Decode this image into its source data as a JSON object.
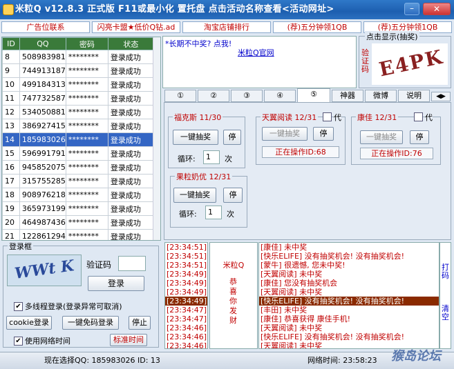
{
  "window": {
    "title": "米粒Q v12.8.3 正式版   F11或最小化 置托盘   点击活动名称查看<活动网址>",
    "min_label": "–",
    "close_label": "✕"
  },
  "ads": [
    "广告位联系",
    "闪亮卡盟★低价Q钻.ad",
    "淘宝店铺排行",
    "(荐)五分钟领1QB",
    "(荐)五分钟领1QB"
  ],
  "accounts": {
    "headers": [
      "ID",
      "QQ",
      "密码",
      "状态"
    ],
    "rows": [
      [
        "8",
        "508983981",
        "********",
        "登录成功"
      ],
      [
        "9",
        "744913187",
        "********",
        "登录成功"
      ],
      [
        "10",
        "499184313",
        "********",
        "登录成功"
      ],
      [
        "11",
        "747732587",
        "********",
        "登录成功"
      ],
      [
        "12",
        "534050881",
        "********",
        "登录成功"
      ],
      [
        "13",
        "386927415",
        "********",
        "登录成功"
      ],
      [
        "14",
        "185983026",
        "********",
        "登录成功"
      ],
      [
        "15",
        "596991791",
        "********",
        "登录成功"
      ],
      [
        "16",
        "945852075",
        "********",
        "登录成功"
      ],
      [
        "17",
        "315755285",
        "********",
        "登录成功"
      ],
      [
        "18",
        "908976218",
        "********",
        "登录成功"
      ],
      [
        "19",
        "365973199",
        "********",
        "登录成功"
      ],
      [
        "20",
        "464987436",
        "********",
        "登录成功"
      ],
      [
        "21",
        "122861294",
        "********",
        "登录成功"
      ]
    ]
  },
  "login": {
    "legend": "登录框",
    "captcha_label": "验证码",
    "captcha_value": "",
    "login_button": "登录",
    "multithread_label": "多线程登录(登录异常可取消)",
    "cookie_button": "cookie登录",
    "quick_button": "一键免码登录",
    "stop_button": "停止",
    "network_time_label": "使用网络时间",
    "standard_time_button": "标准时间",
    "captcha_image_text": "WWt K"
  },
  "notice": {
    "line1": "*长期不中奖? 点我!",
    "line2": "米粒Q官网"
  },
  "captcha_panel": {
    "legend": "点击显示(抽奖)",
    "label": "验证码",
    "image_text": "E4PK"
  },
  "tabs": [
    "①",
    "②",
    "③",
    "④",
    "⑤",
    "神器",
    "微博",
    "说明"
  ],
  "groups": [
    {
      "title": "福克斯 11/30",
      "draw": "一键抽奖",
      "stop": "停",
      "loop_label": "循环:",
      "loop_value": "1",
      "loop_unit": "次"
    },
    {
      "title": "天翼阅读 12/31",
      "proxy": "代",
      "draw": "一键抽奖",
      "stop": "停",
      "status": "正在操作ID:68"
    },
    {
      "title": "康佳 12/31",
      "proxy": "代",
      "draw": "一键抽奖",
      "stop": "停",
      "status": "正在操作ID:76"
    },
    {
      "title": "果粒奶优 12/31",
      "draw": "一键抽奖",
      "stop": "停",
      "loop_label": "循环:",
      "loop_value": "1",
      "loop_unit": "次"
    }
  ],
  "log": {
    "times": [
      "[23:34:51]",
      "[23:34:51]",
      "[23:34:51]",
      "[23:34:49]",
      "[23:34:49]",
      "[23:34:49]",
      "[23:34:49]",
      "[23:34:47]",
      "[23:34:47]",
      "[23:34:46]",
      "[23:34:46]",
      "[23:34:46]"
    ],
    "middle_title": "米粒Q",
    "middle_text": "恭喜你发财",
    "messages": [
      "[康佳] 未中奖",
      "[快乐ELIFE] 没有抽奖机会! 没有抽奖机会!",
      "[蒙牛] 很遗憾, 您未中奖!",
      "[天翼阅读] 未中奖",
      "[康佳] 您没有抽奖机会",
      "[天翼阅读] 未中奖",
      "[快乐ELIFE] 没有抽奖机会! 没有抽奖机会!",
      "[丰田] 未中奖",
      "[康佳] 恭喜获得 康佳手机!",
      "[天翼阅读] 未中奖",
      "[快乐ELIFE] 没有抽奖机会! 没有抽奖机会!",
      "[天翼阅读] 未中奖"
    ],
    "side_top": "打码",
    "side_bottom": "清空"
  },
  "statusbar": {
    "current": "现在选择QQ: 185983026  ID: 13",
    "network_time": "网络时间: 23:58:23",
    "watermark": "猴岛论坛"
  }
}
